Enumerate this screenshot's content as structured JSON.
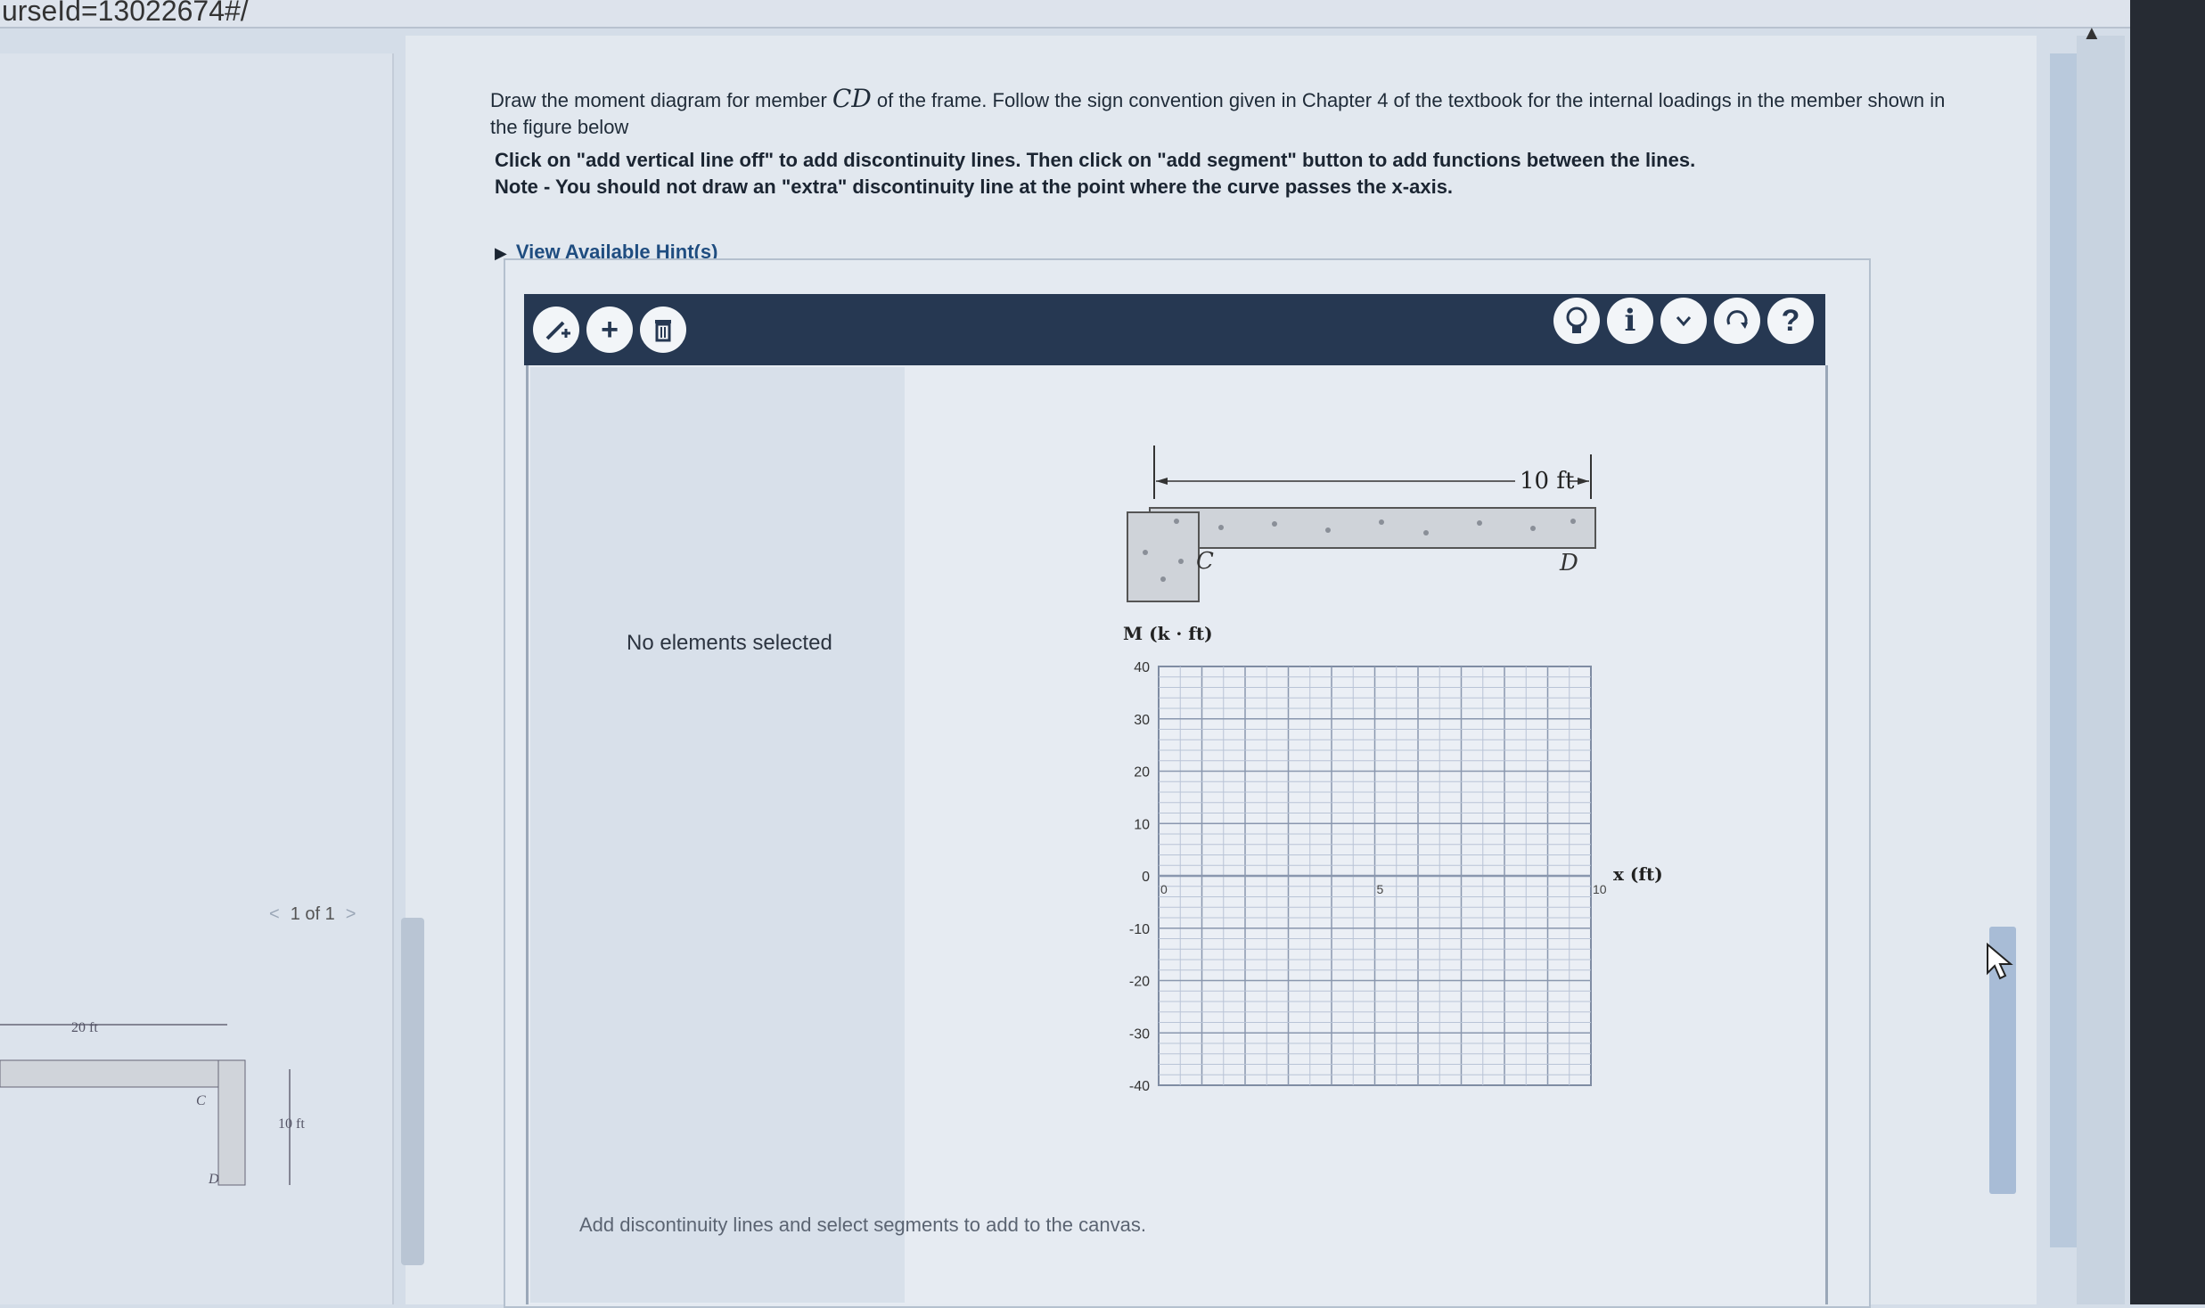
{
  "url_fragment": "urseId=13022674#/",
  "prompt": {
    "line1_pre": "Draw the moment diagram for member ",
    "member": "CD",
    "line1_post": " of the frame. Follow the sign convention given in Chapter 4 of the textbook for the internal loadings in the member shown in the figure below",
    "instruction": "Click on \"add vertical line off\" to add discontinuity lines. Then click on \"add segment\" button to add functions between the lines.",
    "note": "Note - You should not draw an \"extra\" discontinuity line at the point where the curve passes the x-axis."
  },
  "hints_link": "View Available Hint(s)",
  "toolbar": {
    "left_icons": [
      "add-vertical-line-icon",
      "add-segment-icon",
      "trash-icon"
    ],
    "add_label": "+",
    "right_icons": [
      "lightbulb-icon",
      "info-icon",
      "chevron-down-icon",
      "reset-icon",
      "help-icon"
    ],
    "info_label": "i",
    "help_label": "?"
  },
  "side_panel": {
    "status": "No elements selected"
  },
  "canvas_message": "Add discontinuity lines and select segments to add to the canvas.",
  "pager": {
    "text": "1 of 1"
  },
  "mini_figure": {
    "span": "20 ft",
    "height": "10 ft",
    "c": "C",
    "d": "D"
  },
  "figure": {
    "dimension": "10 ft",
    "label_c": "C",
    "label_d": "D",
    "y_axis_title": "M (k · ft)",
    "x_axis_title": "x (ft)",
    "y_ticks": [
      "40",
      "30",
      "20",
      "10",
      "0",
      "-10",
      "-20",
      "-30",
      "-40"
    ],
    "x_ticks": [
      "0",
      "5",
      "10"
    ]
  },
  "colors": {
    "toolbar": "#263852",
    "link": "#1f4d80",
    "grid_major": "#8a97ae",
    "grid_minor": "#b9c4d6"
  }
}
